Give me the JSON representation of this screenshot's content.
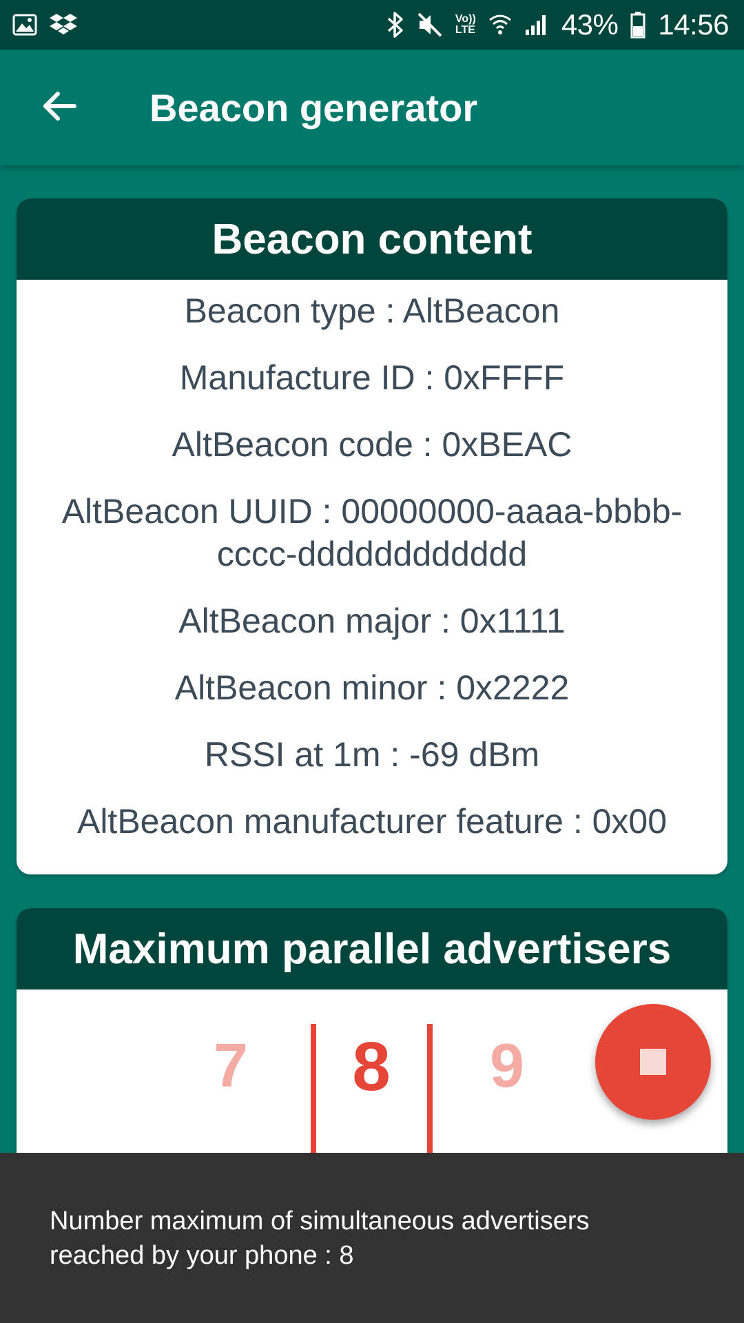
{
  "status_bar": {
    "battery": "43%",
    "time": "14:56",
    "network_top": "Vo))",
    "network_bottom": "LTE",
    "icons": [
      "gallery-icon",
      "dropbox-icon",
      "bluetooth-icon",
      "mute-icon",
      "wifi-icon",
      "signal-icon",
      "battery-icon"
    ]
  },
  "app_bar": {
    "title": "Beacon generator",
    "back_icon": "arrow-back-icon",
    "background_color": "#00796b"
  },
  "beacon_content": {
    "header": "Beacon content",
    "lines": [
      "Beacon type : AltBeacon",
      "Manufacture ID : 0xFFFF",
      "AltBeacon code : 0xBEAC",
      "AltBeacon UUID : 00000000-aaaa-bbbb-cccc-dddddddddddd",
      "AltBeacon major : 0x1111",
      "AltBeacon minor : 0x2222",
      "RSSI at 1m : -69 dBm",
      "AltBeacon manufacturer feature : 0x00"
    ]
  },
  "advertisers": {
    "header": "Maximum parallel advertisers",
    "picker": {
      "previous": "7",
      "selected": "8",
      "next": "9"
    }
  },
  "fab": {
    "icon": "stop-icon",
    "color": "#e64637"
  },
  "snackbar": {
    "message": "Number maximum of simultaneous advertisers\nreached by your phone : 8"
  },
  "colors": {
    "primary": "#00796b",
    "primary_dark": "#00463d",
    "accent": "#e64637",
    "text": "#3b4b57"
  }
}
